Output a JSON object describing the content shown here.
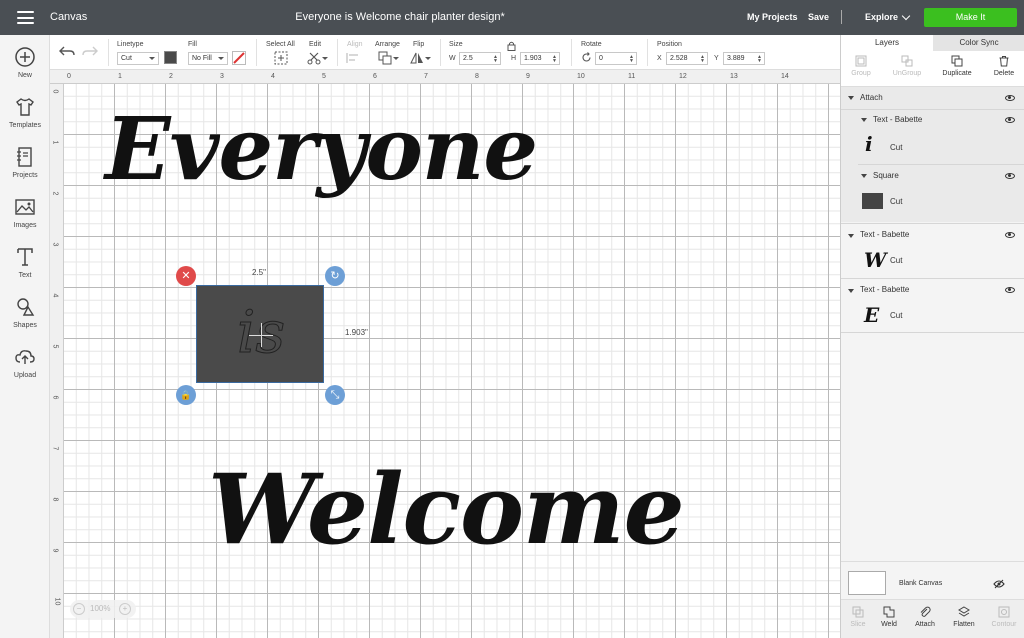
{
  "topbar": {
    "app_title": "Canvas",
    "doc_title": "Everyone is Welcome chair planter design*",
    "my_projects": "My Projects",
    "save": "Save",
    "sep": "|",
    "explore": "Explore",
    "make_it": "Make It"
  },
  "sidebar": {
    "items": [
      {
        "label": "New",
        "icon": "plus-circle-icon"
      },
      {
        "label": "Templates",
        "icon": "shirt-icon"
      },
      {
        "label": "Projects",
        "icon": "notebook-icon"
      },
      {
        "label": "Images",
        "icon": "image-icon"
      },
      {
        "label": "Text",
        "icon": "text-t-icon"
      },
      {
        "label": "Shapes",
        "icon": "shapes-icon"
      },
      {
        "label": "Upload",
        "icon": "cloud-upload-icon"
      }
    ]
  },
  "toolbar": {
    "linetype_label": "Linetype",
    "linetype_value": "Cut",
    "fill_label": "Fill",
    "fill_value": "No Fill",
    "select_all_label": "Select All",
    "edit_label": "Edit",
    "align_label": "Align",
    "arrange_label": "Arrange",
    "flip_label": "Flip",
    "size_label": "Size",
    "w_label": "W",
    "w_value": "2.5",
    "h_label": "H",
    "h_value": "1.903",
    "rotate_label": "Rotate",
    "rotate_value": "0",
    "position_label": "Position",
    "x_label": "X",
    "x_value": "2.528",
    "y_label": "Y",
    "y_value": "3.889",
    "swatch_color": "#4a4a4a"
  },
  "canvas": {
    "ruler_top": [
      "0",
      "1",
      "2",
      "3",
      "4",
      "5",
      "6",
      "7",
      "8",
      "9",
      "10",
      "11",
      "12",
      "13",
      "14"
    ],
    "ruler_left": [
      "0",
      "1",
      "2",
      "3",
      "4",
      "5",
      "6",
      "7",
      "8",
      "9",
      "10"
    ],
    "word_top": "Everyone",
    "word_bottom": "Welcome",
    "selection_text": "is",
    "selection_width": "2.5\"",
    "selection_height": "1.903\"",
    "zoom": "100%",
    "zoom_minus": "−",
    "zoom_plus": "+",
    "delete_glyph": "✕",
    "rotate_glyph": "↻",
    "lock_glyph": "🔒",
    "resize_glyph": "⤡",
    "handle_delete_color": "#e04a4a",
    "handle_blue_color": "#6d9fd6"
  },
  "layers": {
    "tab_layers": "Layers",
    "tab_color_sync": "Color Sync",
    "actions": {
      "group": "Group",
      "ungroup": "UnGroup",
      "duplicate": "Duplicate",
      "delete": "Delete"
    },
    "attach": "Attach",
    "items": [
      {
        "name": "Text - Babette",
        "op": "Cut",
        "glyph": "i"
      },
      {
        "name": "Square",
        "op": "Cut"
      },
      {
        "name": "Text - Babette",
        "op": "Cut",
        "glyph": "W"
      },
      {
        "name": "Text - Babette",
        "op": "Cut",
        "glyph": "E"
      }
    ],
    "blank_canvas": "Blank Canvas",
    "bottom_actions": {
      "slice": "Slice",
      "weld": "Weld",
      "attach": "Attach",
      "flatten": "Flatten",
      "contour": "Contour"
    }
  }
}
